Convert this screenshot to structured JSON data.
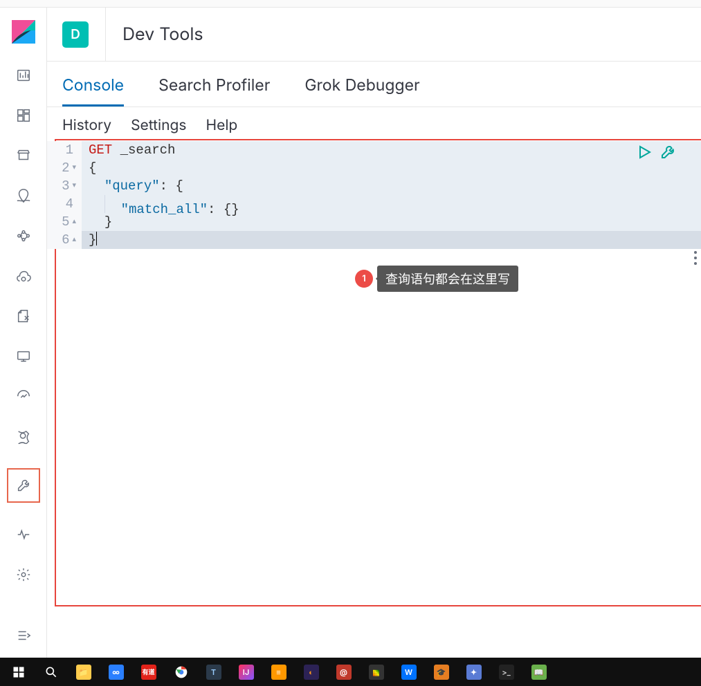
{
  "header": {
    "space_initial": "D",
    "title": "Dev Tools"
  },
  "tabs": [
    {
      "label": "Console",
      "active": true
    },
    {
      "label": "Search Profiler",
      "active": false
    },
    {
      "label": "Grok Debugger",
      "active": false
    }
  ],
  "submenu": [
    {
      "label": "History"
    },
    {
      "label": "Settings"
    },
    {
      "label": "Help"
    }
  ],
  "editor": {
    "lines": [
      {
        "n": "1",
        "fold": "",
        "method": "GET",
        "rest": " _search"
      },
      {
        "n": "2",
        "fold": "▾",
        "text": "{"
      },
      {
        "n": "3",
        "fold": "▾",
        "indent": 1,
        "key": "\"query\"",
        "after": ": {"
      },
      {
        "n": "4",
        "fold": "",
        "indent": 2,
        "key": "\"match_all\"",
        "after": ": {}"
      },
      {
        "n": "5",
        "fold": "▴",
        "indent": 1,
        "text": "}"
      },
      {
        "n": "6",
        "fold": "▴",
        "text": "}",
        "cursor": true,
        "last": true
      }
    ]
  },
  "callout": {
    "number": "1",
    "text": "查询语句都会在这里写"
  },
  "sidebar_icons": [
    "discover",
    "dashboard",
    "canvas",
    "maps",
    "ml",
    "infra",
    "logs",
    "apm",
    "uptime",
    "siem",
    "dev-tools",
    "monitoring",
    "management"
  ],
  "taskbar_icons": [
    "windows-start",
    "search",
    "file-explorer",
    "baidu",
    "youdao",
    "chrome",
    "todesk",
    "intellij",
    "sublime",
    "eclipse",
    "spiral",
    "pixel",
    "wps",
    "edu",
    "flutter",
    "terminal",
    "book"
  ]
}
